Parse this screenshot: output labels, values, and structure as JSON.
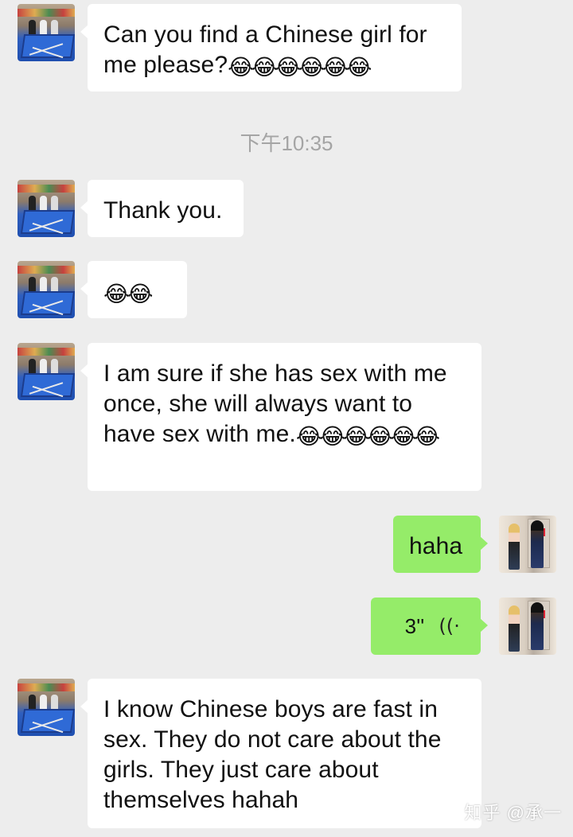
{
  "messages": [
    {
      "side": "left",
      "text": "Can you find a Chinese girl for me please?",
      "emoji": "😂😂😂😂😂😂"
    },
    {
      "side": "left",
      "text": "Thank you.",
      "emoji": ""
    },
    {
      "side": "left",
      "text": "",
      "emoji": "😂😂"
    },
    {
      "side": "left",
      "text": "I am sure if she has sex with me once, she will always want to have sex with me.",
      "emoji": "😂😂😂😂😂😂"
    },
    {
      "side": "right",
      "text": "haha",
      "emoji": ""
    },
    {
      "side": "right",
      "voice_duration": "3''",
      "voice_icon": "((·"
    },
    {
      "side": "left",
      "text": "I know Chinese boys are fast in sex. They do not care about the girls. They just care about themselves hahah",
      "emoji": ""
    }
  ],
  "timestamp": "下午10:35",
  "watermark": "知乎 @承一",
  "colors": {
    "background": "#ededed",
    "incoming_bubble": "#ffffff",
    "outgoing_bubble": "#95ec69",
    "timestamp": "#a5a5a5"
  },
  "icons": {
    "contact_avatar": "avatar-pool-table",
    "my_avatar": "avatar-two-girls",
    "voice": "voice-wave-icon"
  }
}
